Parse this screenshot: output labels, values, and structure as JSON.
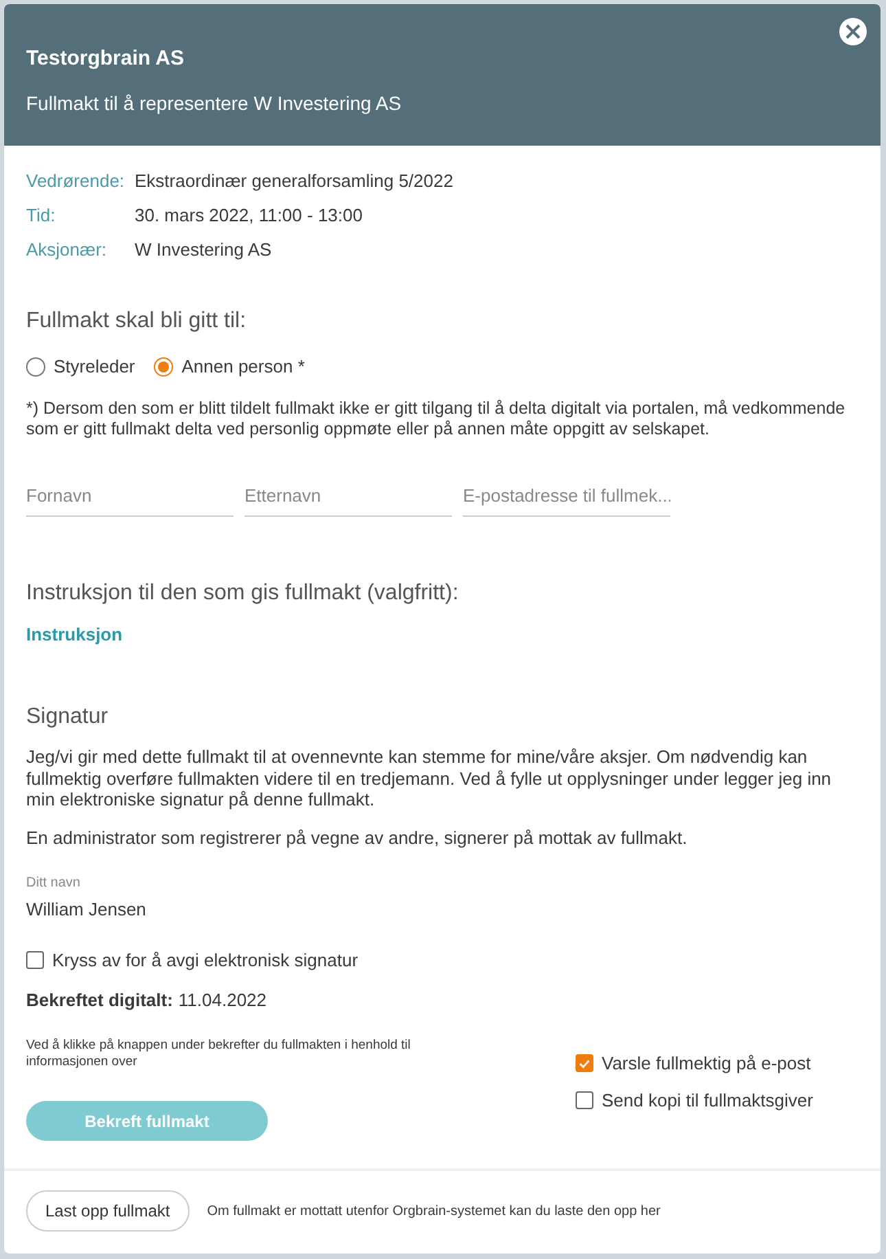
{
  "header": {
    "company": "Testorgbrain AS",
    "subtitle": "Fullmakt til å representere W Investering AS"
  },
  "details": [
    {
      "label": "Vedrørende:",
      "value": "Ekstraordinær generalforsamling 5/2022"
    },
    {
      "label": "Tid:",
      "value": "30. mars 2022, 11:00 - 13:00"
    },
    {
      "label": "Aksjonær:",
      "value": "W Investering AS"
    }
  ],
  "recipient": {
    "heading": "Fullmakt skal bli gitt til:",
    "options": [
      {
        "label": "Styreleder",
        "selected": false
      },
      {
        "label": "Annen person *",
        "selected": true
      }
    ],
    "note": "*) Dersom den som er blitt tildelt fullmakt ikke er gitt tilgang til å delta digitalt via portalen, må vedkommende som er gitt fullmakt delta ved personlig oppmøte eller på annen måte oppgitt av selskapet.",
    "fields": [
      {
        "placeholder": "Fornavn"
      },
      {
        "placeholder": "Etternavn"
      },
      {
        "placeholder": "E-postadresse til fullmek..."
      }
    ]
  },
  "instruction": {
    "heading": "Instruksjon til den som gis fullmakt (valgfritt):",
    "link": "Instruksjon"
  },
  "signature": {
    "heading": "Signatur",
    "paragraphs": [
      "Jeg/vi gir med dette fullmakt til at ovennevnte kan stemme for mine/våre aksjer. Om nødvendig kan fullmektig overføre fullmakten videre til en tredjemann. Ved å fylle ut opplysninger under legger jeg inn min elektroniske signatur på denne fullmakt.",
      "En administrator som registrerer på vegne av andre, signerer på mottak av fullmakt."
    ],
    "name_label": "Ditt navn",
    "name_value": "William Jensen",
    "sign_checkbox": {
      "label": "Kryss av for å avgi elektronisk signatur",
      "checked": false
    },
    "confirmed_label": "Bekreftet digitalt:",
    "confirmed_value": "11.04.2022",
    "confirm_note": "Ved å klikke på knappen under bekrefter du fullmakten i henhold til informasjonen over",
    "confirm_button": {
      "label": "Bekreft fullmakt",
      "disabled": true
    },
    "options": [
      {
        "label": "Varsle fullmektig på e-post",
        "checked": true
      },
      {
        "label": "Send kopi til fullmaktsgiver",
        "checked": false
      }
    ]
  },
  "footer": {
    "button": "Last opp fullmakt",
    "note": "Om fullmakt er mottatt utenfor Orgbrain-systemet kan du laste den opp her"
  }
}
